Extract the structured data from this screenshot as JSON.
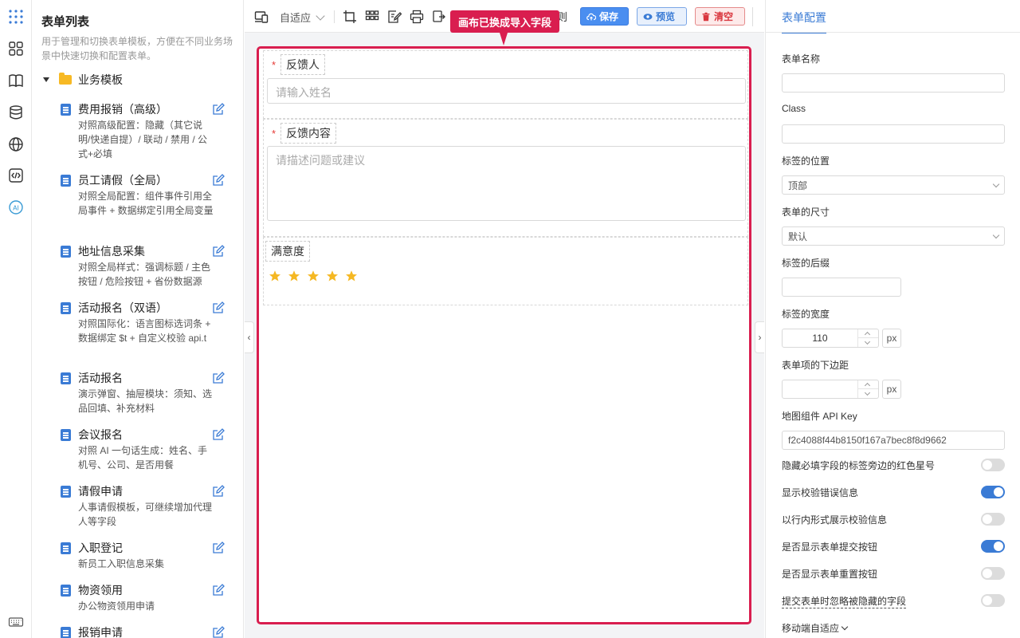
{
  "rail": {
    "icons": [
      "apps-grid-icon",
      "components-icon",
      "book-icon",
      "database-icon",
      "globe-icon",
      "code-icon",
      "ai-icon",
      "keyboard-icon"
    ]
  },
  "template_list": {
    "title": "表单列表",
    "description": "用于管理和切换表单模板，方便在不同业务场景中快速切换和配置表单。",
    "folder": "业务模板",
    "items": [
      {
        "title": "费用报销（高级）",
        "desc": "对照高级配置：隐藏（其它说明/快递自提）/ 联动 / 禁用 / 公式+必填"
      },
      {
        "title": "员工请假（全局）",
        "desc": "对照全局配置：组件事件引用全局事件 + 数据绑定引用全局变量"
      },
      {
        "title": "地址信息采集",
        "desc": "对照全局样式：强调标题 / 主色按钮 / 危险按钮 + 省份数据源"
      },
      {
        "title": "活动报名（双语）",
        "desc": "对照国际化：语言图标选词条 + 数据绑定 $t + 自定义校验 api.t"
      },
      {
        "title": "活动报名",
        "desc": "演示弹窗、抽屉模块：须知、选品回填、补充材料"
      },
      {
        "title": "会议报名",
        "desc": "对照 AI 一句话生成：姓名、手机号、公司、是否用餐"
      },
      {
        "title": "请假申请",
        "desc": "人事请假模板，可继续增加代理人等字段"
      },
      {
        "title": "入职登记",
        "desc": "新员工入职信息采集"
      },
      {
        "title": "物资领用",
        "desc": "办公物资领用申请"
      },
      {
        "title": "报销申请",
        "desc": ""
      }
    ]
  },
  "toolbar": {
    "layout_select": "自适应",
    "save": "保存",
    "preview": "预览",
    "clear": "清空",
    "tooltip": "画布已换成导入字段",
    "hidden_text": "则"
  },
  "canvas": {
    "fields": [
      {
        "label": "反馈人",
        "required": "*",
        "placeholder": "请输入姓名"
      },
      {
        "label": "反馈内容",
        "required": "*",
        "placeholder": "请描述问题或建议"
      },
      {
        "label": "满意度",
        "stars": 5
      }
    ]
  },
  "config": {
    "tab": "表单配置",
    "form_name_label": "表单名称",
    "form_name_value": "",
    "class_label": "Class",
    "class_value": "",
    "label_position_label": "标签的位置",
    "label_position_value": "顶部",
    "form_size_label": "表单的尺寸",
    "form_size_value": "默认",
    "label_suffix_label": "标签的后缀",
    "label_suffix_value": "",
    "label_width_label": "标签的宽度",
    "label_width_value": "110",
    "unit_px": "px",
    "item_margin_label": "表单项的下边距",
    "item_margin_value": "",
    "map_key_label": "地图组件 API Key",
    "map_key_value": "f2c4088f44b8150f167a7bec8f8d9662",
    "switches": [
      {
        "label": "隐藏必填字段的标签旁边的红色星号",
        "on": false
      },
      {
        "label": "显示校验错误信息",
        "on": true
      },
      {
        "label": "以行内形式展示校验信息",
        "on": false
      },
      {
        "label": "是否显示表单提交按钮",
        "on": true
      },
      {
        "label": "是否显示表单重置按钮",
        "on": false
      },
      {
        "label": "提交表单时忽略被隐藏的字段",
        "on": false
      }
    ],
    "mobile_label": "移动端自适应"
  }
}
